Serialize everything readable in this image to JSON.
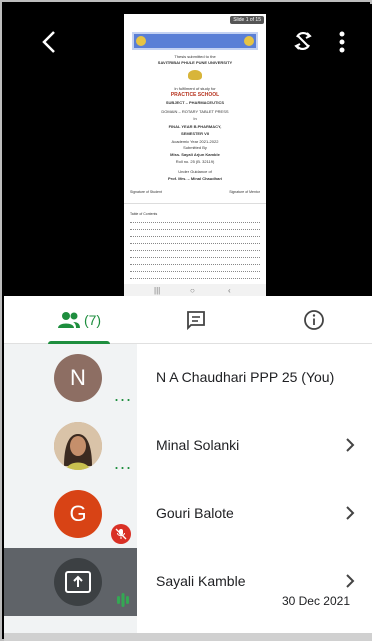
{
  "slide": {
    "counter": "Slide 1 of 15",
    "submitted_to": "Thesis submitted to the",
    "university": "SAVITRIBAI PHULE PUNE UNIVERSITY",
    "fulfilment": "In fulfilment of study for",
    "title": "PRACTICE SCHOOL",
    "subject": "SUBJECT – PHARMACEUTICS",
    "domain": "DOMAIN – ROTARY TABLET PRESS",
    "in": "In",
    "year": "FINAL YEAR B.PHARMACY,",
    "semester": "SEMESTER VII",
    "academic": "Academic Year 2021-2022",
    "submitted_by": "Submitted By",
    "student": "Miss. Sayali Arjun Kamble",
    "roll": "Roll no. 25 (B. 32119)",
    "guidance": "Under Guidance of",
    "guide": "Prof. Mrs. – Minal Chaudhari",
    "sig_left": "Signature of Student",
    "sig_right": "Signature of Mentor",
    "toc_title": "Table of Contents"
  },
  "tabs": {
    "people_count": "(7)"
  },
  "participants": [
    {
      "initial": "N",
      "name": "N A Chaudhari PPP 25 (You)",
      "avatar_color": "#8d6e63"
    },
    {
      "initial": "",
      "name": "Minal Solanki",
      "avatar_color": "#c9a27e"
    },
    {
      "initial": "G",
      "name": "Gouri Balote",
      "avatar_color": "#d84315"
    },
    {
      "initial": "",
      "name": "Sayali Kamble",
      "avatar_color": "#3c4043"
    }
  ],
  "footer": {
    "date": "30 Dec 2021"
  }
}
